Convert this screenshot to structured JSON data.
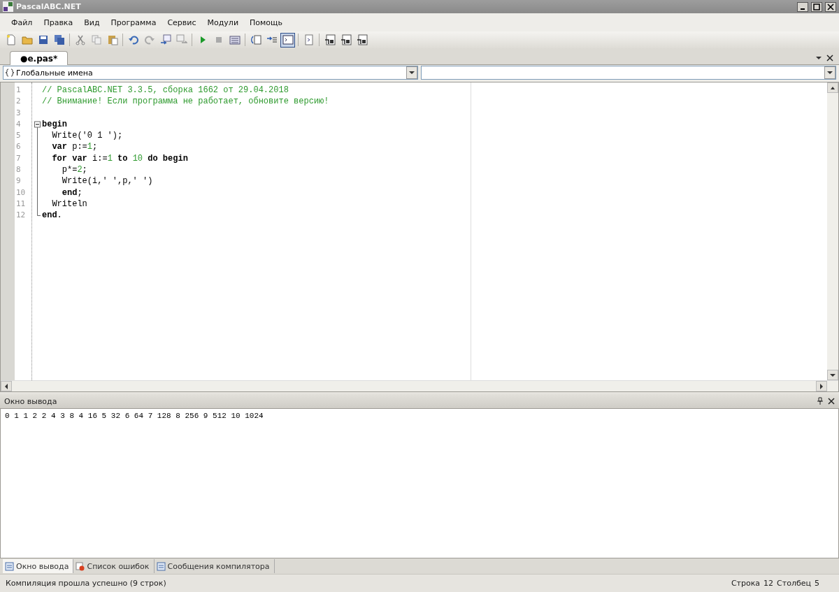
{
  "window": {
    "title": "PascalABC.NET"
  },
  "menu": [
    "Файл",
    "Правка",
    "Вид",
    "Программа",
    "Сервис",
    "Модули",
    "Помощь"
  ],
  "toolbar": [
    [
      {
        "kind": "new",
        "pressed": false
      },
      {
        "kind": "open",
        "pressed": false
      },
      {
        "kind": "save",
        "pressed": false
      },
      {
        "kind": "save-all",
        "pressed": false
      }
    ],
    [
      {
        "kind": "cut",
        "pressed": false
      },
      {
        "kind": "copy",
        "pressed": false
      },
      {
        "kind": "paste",
        "pressed": false
      }
    ],
    [
      {
        "kind": "undo",
        "pressed": false
      },
      {
        "kind": "redo",
        "pressed": false
      },
      {
        "kind": "find",
        "pressed": false
      },
      {
        "kind": "replace",
        "pressed": false
      }
    ],
    [
      {
        "kind": "run",
        "pressed": false
      },
      {
        "kind": "stop",
        "pressed": false
      },
      {
        "kind": "compile",
        "pressed": false
      }
    ],
    [
      {
        "kind": "step-into",
        "pressed": false
      },
      {
        "kind": "step-over",
        "pressed": false
      },
      {
        "kind": "console",
        "pressed": true
      }
    ],
    [
      {
        "kind": "doc",
        "pressed": false
      }
    ],
    [
      {
        "kind": "d",
        "pressed": false
      },
      {
        "kind": "l",
        "pressed": false
      },
      {
        "kind": "r",
        "pressed": false
      }
    ]
  ],
  "tabs": [
    {
      "label": "●e.pas*",
      "selected": true
    }
  ],
  "scope_dropdown": {
    "value": "Глобальные имена"
  },
  "editor": {
    "lines": [
      {
        "number": "1",
        "tokens": [
          {
            "kind": "comment",
            "text": "// PascalABC.NET 3.3.5, сборка 1662 от 29.04.2018"
          }
        ]
      },
      {
        "number": "2",
        "tokens": [
          {
            "kind": "comment",
            "text": "// Внимание! Если программа не работает, обновите версию!"
          }
        ]
      },
      {
        "number": "3"
      },
      {
        "number": "4",
        "expanded": true,
        "tokens": [
          {
            "kind": "keyword",
            "text": "begin"
          }
        ],
        "children": [
          {
            "number": "5",
            "tokens": [
              {
                "kind": "plain",
                "text": "Write('0 1 ');"
              }
            ]
          },
          {
            "number": "6",
            "tokens": [
              {
                "kind": "keyword",
                "text": "var"
              },
              {
                "kind": "plain",
                "text": " p:="
              },
              {
                "kind": "number",
                "text": "1"
              },
              {
                "kind": "plain",
                "text": ";"
              }
            ]
          },
          {
            "number": "7",
            "tokens": [
              {
                "kind": "keyword",
                "text": "for var"
              },
              {
                "kind": "plain",
                "text": " i:="
              },
              {
                "kind": "number",
                "text": "1"
              },
              {
                "kind": "keyword",
                "text": " to "
              },
              {
                "kind": "number",
                "text": "10"
              },
              {
                "kind": "keyword",
                "text": " do begin"
              }
            ],
            "children": [
              {
                "number": "8",
                "tokens": [
                  {
                    "kind": "plain",
                    "text": "p*="
                  },
                  {
                    "kind": "number",
                    "text": "2"
                  },
                  {
                    "kind": "plain",
                    "text": ";"
                  }
                ]
              },
              {
                "number": "9",
                "tokens": [
                  {
                    "kind": "plain",
                    "text": "Write(i,' ',p,' ')"
                  }
                ]
              },
              {
                "number": "10",
                "tokens": [
                  {
                    "kind": "keyword",
                    "text": "end"
                  },
                  {
                    "kind": "plain",
                    "text": ";"
                  }
                ]
              }
            ]
          },
          {
            "number": "11",
            "tokens": [
              {
                "kind": "plain",
                "text": "Writeln"
              }
            ]
          }
        ]
      },
      {
        "number": "12",
        "tokens": [
          {
            "kind": "keyword",
            "text": "end"
          },
          {
            "kind": "plain",
            "text": "."
          }
        ]
      }
    ]
  },
  "output_panel": {
    "title": "Окно вывода",
    "text": "0 1 1 2 2 4 3 8 4 16 5 32 6 64 7 128 8 256 9 512 10 1024"
  },
  "bottom_tabs": [
    {
      "label": "Окно вывода",
      "kind": "output",
      "selected": true
    },
    {
      "label": "Список ошибок",
      "kind": "errors",
      "selected": false
    },
    {
      "label": "Сообщения компилятора",
      "kind": "messages",
      "selected": false
    }
  ],
  "status_bar": {
    "message": "Компиляция прошла успешно (9 строк)",
    "line_label": "Строка",
    "line": "12",
    "column_label": "Столбец",
    "column": "5"
  }
}
